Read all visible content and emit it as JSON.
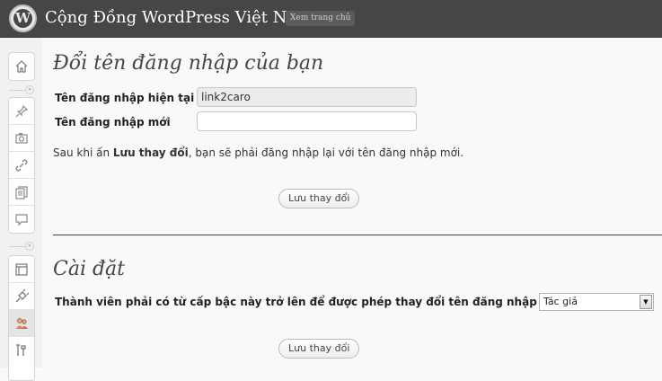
{
  "header": {
    "logo_letter": "W",
    "site_title": "Cộng Đồng WordPress Việt Nam",
    "view_site": "Xem trang chủ"
  },
  "sidebar": {
    "icons": [
      "dashboard-icon",
      "pin-icon",
      "media-icon",
      "link-icon",
      "pages-icon",
      "comments-icon",
      "appearance-icon",
      "plugins-icon",
      "users-icon",
      "tools-icon"
    ],
    "separator_glyph": "»"
  },
  "rename_section": {
    "title": "Đổi tên đăng nhập của bạn",
    "current_label": "Tên đăng nhập hiện tại",
    "current_value": "link2caro",
    "new_label": "Tên đăng nhập mới",
    "new_value": "",
    "note_prefix": "Sau khi ấn ",
    "note_bold": "Lưu thay đổi",
    "note_suffix": ", bạn sẽ phải đăng nhập lại với tên đăng nhập mới.",
    "save_button": "Lưu thay đổi"
  },
  "settings_section": {
    "title": "Cài đặt",
    "role_label": "Thành viên phải có từ cấp bậc này trở lên để được phép thay đổi tên đăng nhập",
    "role_selected": "Tác giả",
    "save_button": "Lưu thay đổi"
  }
}
